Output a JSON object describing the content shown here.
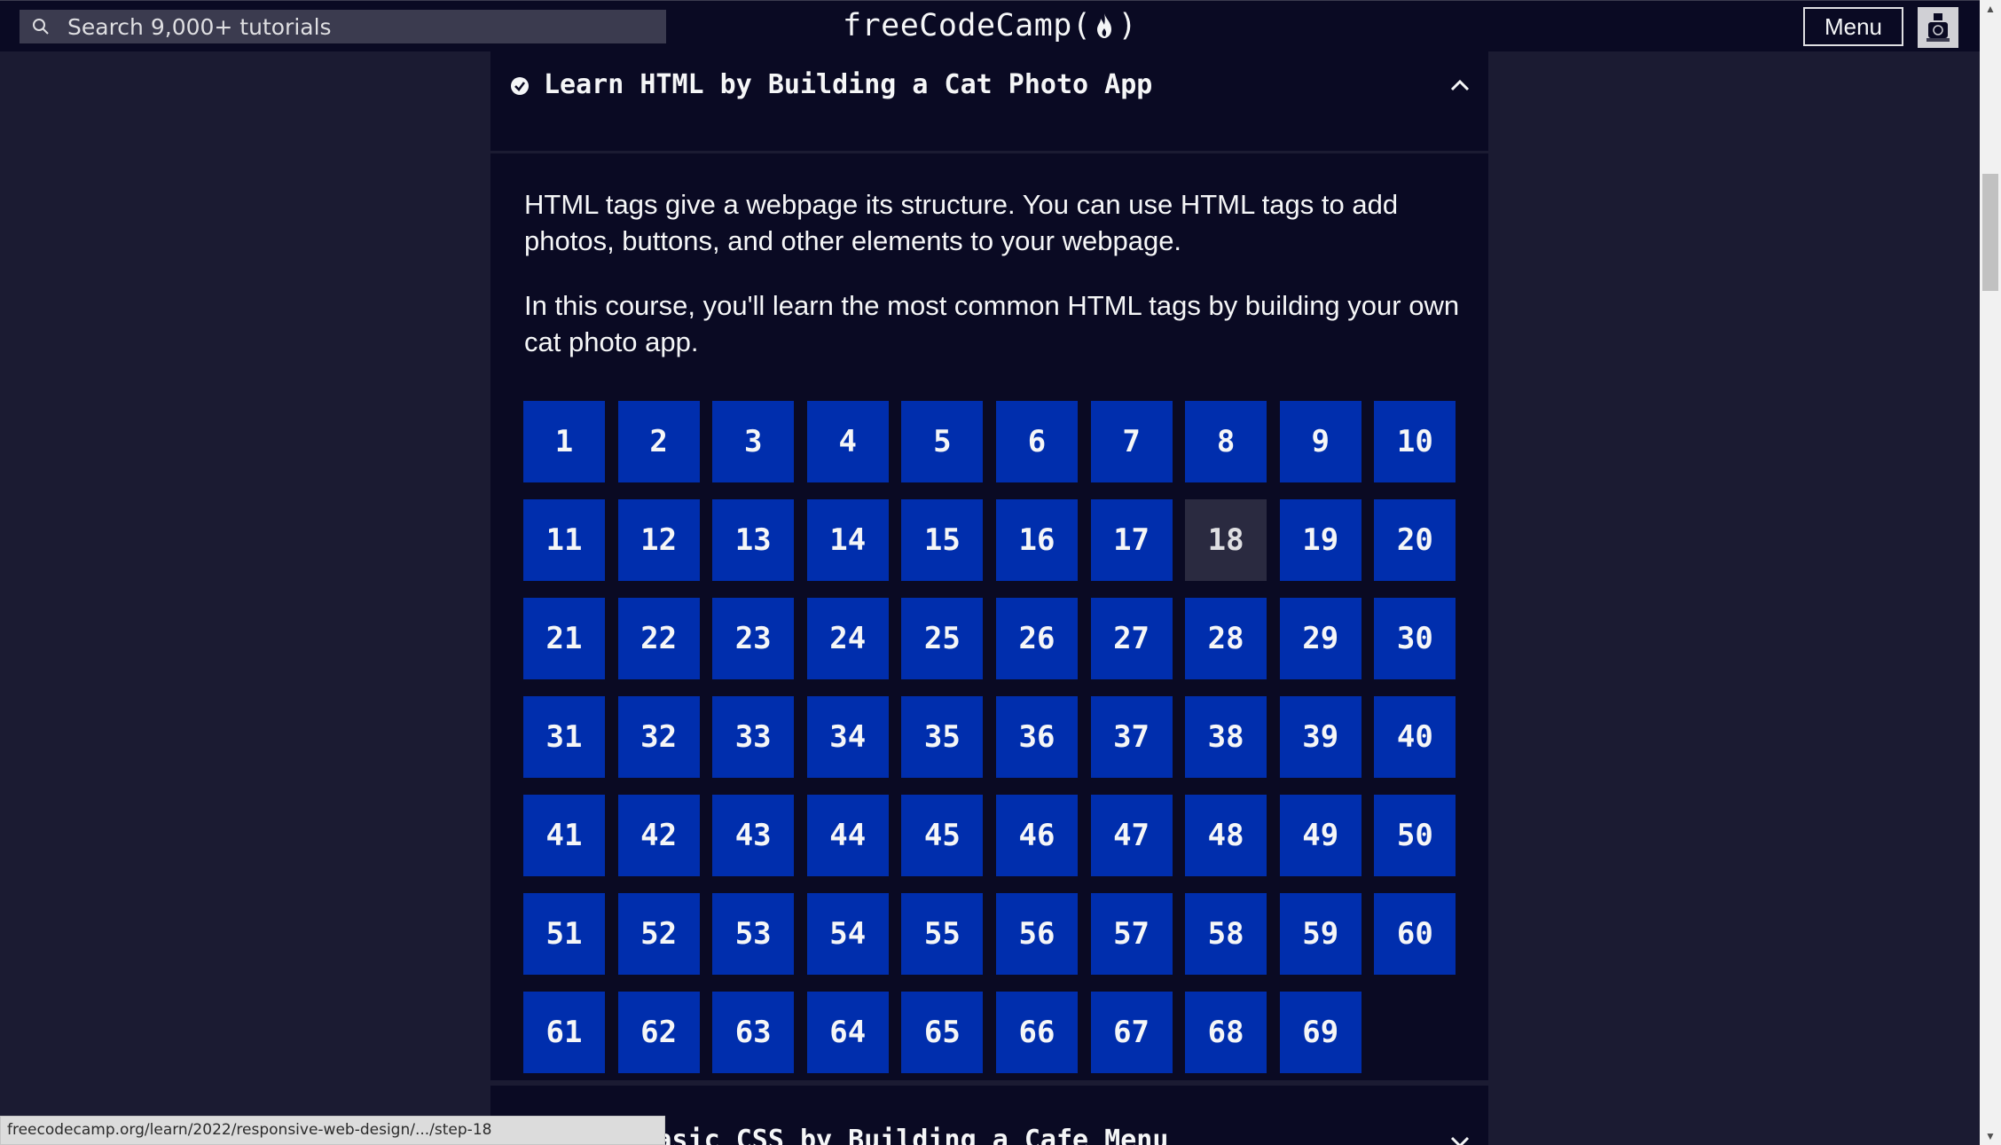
{
  "nav": {
    "search_placeholder": "Search 9,000+ tutorials",
    "logo_prefix": "freeCodeCamp(",
    "logo_suffix": ")",
    "menu_label": "Menu"
  },
  "course": {
    "title": "Learn HTML by Building a Cat Photo App",
    "description": [
      "HTML tags give a webpage its structure. You can use HTML tags to add photos, buttons, and other elements to your webpage.",
      "In this course, you'll learn the most common HTML tags by building your own cat photo app."
    ],
    "steps": [
      "1",
      "2",
      "3",
      "4",
      "5",
      "6",
      "7",
      "8",
      "9",
      "10",
      "11",
      "12",
      "13",
      "14",
      "15",
      "16",
      "17",
      "18",
      "19",
      "20",
      "21",
      "22",
      "23",
      "24",
      "25",
      "26",
      "27",
      "28",
      "29",
      "30",
      "31",
      "32",
      "33",
      "34",
      "35",
      "36",
      "37",
      "38",
      "39",
      "40",
      "41",
      "42",
      "43",
      "44",
      "45",
      "46",
      "47",
      "48",
      "49",
      "50",
      "51",
      "52",
      "53",
      "54",
      "55",
      "56",
      "57",
      "58",
      "59",
      "60",
      "61",
      "62",
      "63",
      "64",
      "65",
      "66",
      "67",
      "68",
      "69"
    ],
    "current_step": "18"
  },
  "next_course": {
    "title": "Learn Basic CSS by Building a Cafe Menu"
  },
  "status_url": "freecodecamp.org/learn/2022/responsive-web-design/.../step-18",
  "colors": {
    "nav_bg": "#0a0a23",
    "page_bg": "#1b1b32",
    "step_bg": "#002ead",
    "step_current_bg": "#2a2a40",
    "text": "#f5f6f7"
  }
}
